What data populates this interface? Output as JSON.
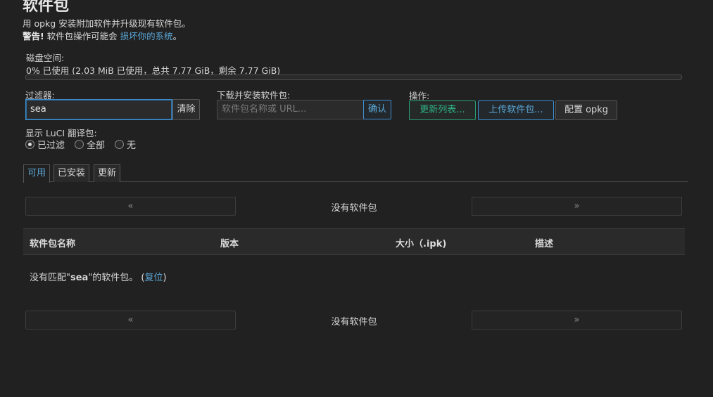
{
  "page": {
    "title": "软件包",
    "description": "用 opkg 安装附加软件并升级现有软件包。",
    "warning_prefix": "警告!",
    "warning_text": " 软件包操作可能会 ",
    "warning_link": "损坏你的系统",
    "warning_suffix": "。"
  },
  "disk": {
    "label": "磁盘空间:",
    "usage_text": "0% 已使用 (2.03 MiB 已使用，总共 7.77 GiB，剩余 7.77 GiB)",
    "used_percent": 0
  },
  "filter": {
    "label": "过滤器:",
    "value": "sea",
    "clear_label": "清除"
  },
  "download": {
    "label": "下载并安装软件包:",
    "placeholder": "软件包名称或 URL...",
    "confirm_label": "确认"
  },
  "actions": {
    "label": "操作:",
    "update_lists": "更新列表...",
    "upload_package": "上传软件包...",
    "configure_opkg": "配置 opkg"
  },
  "translations": {
    "label": "显示 LuCI 翻译包:",
    "options": [
      {
        "label": "已过滤",
        "selected": true
      },
      {
        "label": "全部",
        "selected": false
      },
      {
        "label": "无",
        "selected": false
      }
    ]
  },
  "tabs": [
    {
      "label": "可用",
      "active": true
    },
    {
      "label": "已安装",
      "active": false
    },
    {
      "label": "更新",
      "active": false
    }
  ],
  "pager": {
    "prev": "«",
    "next": "»",
    "status": "没有软件包"
  },
  "table": {
    "columns": [
      "软件包名称",
      "版本",
      "大小（.ipk)",
      "描述"
    ],
    "empty_prefix": "没有匹配\"",
    "empty_query": "sea",
    "empty_suffix": "\"的软件包。 (",
    "reset_link": "复位",
    "empty_close": ")"
  },
  "colors": {
    "accent": "#3d8fd1",
    "link": "#5ba8d8",
    "green": "#2fb487",
    "background": "#212121"
  }
}
